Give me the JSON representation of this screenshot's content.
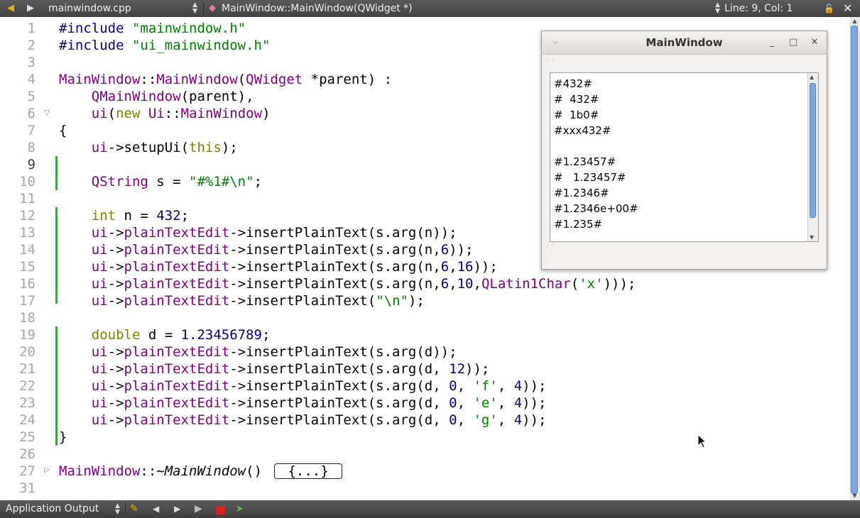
{
  "toolbar": {
    "file_name": "mainwindow.cpp",
    "symbol": "MainWindow::MainWindow(QWidget *)",
    "position": "Line: 9, Col: 1"
  },
  "editor": {
    "line_numbers": [
      "1",
      "2",
      "3",
      "4",
      "5",
      "6",
      "7",
      "8",
      "9",
      "10",
      "11",
      "12",
      "13",
      "14",
      "15",
      "16",
      "17",
      "18",
      "19",
      "20",
      "21",
      "22",
      "23",
      "24",
      "25",
      "26",
      "27",
      "31"
    ],
    "current_line": "9"
  },
  "code": {
    "l1a": "#include ",
    "l1b": "\"mainwindow.h\"",
    "l2a": "#include ",
    "l2b": "\"ui_mainwindow.h\"",
    "l4a": "MainWindow",
    "l4b": "::",
    "l4c": "MainWindow",
    "l4d": "(",
    "l4e": "QWidget",
    "l4f": " *parent) :",
    "l5a": "    ",
    "l5b": "QMainWindow",
    "l5c": "(parent),",
    "l6a": "    ",
    "l6b": "ui",
    "l6c": "(",
    "l6d": "new",
    "l6e": " ",
    "l6f": "Ui",
    "l6g": "::",
    "l6h": "MainWindow",
    "l6i": ")",
    "l7": "{",
    "l8a": "    ",
    "l8b": "ui",
    "l8c": "->setupUi(",
    "l8d": "this",
    "l8e": ");",
    "l10a": "    ",
    "l10b": "QString",
    "l10c": " s = ",
    "l10d": "\"#%1#\\n\"",
    "l10e": ";",
    "l12a": "    ",
    "l12b": "int",
    "l12c": " n = ",
    "l12d": "432",
    "l12e": ";",
    "l13": "s.arg(n));",
    "l14a": "s.arg(n,",
    "l14b": "6",
    "l14c": "));",
    "l15a": "s.arg(n,",
    "l15b": "6",
    "l15c": ",",
    "l15d": "16",
    "l15e": "));",
    "l16a": "s.arg(n,",
    "l16b": "6",
    "l16c": ",",
    "l16d": "10",
    "l16e": ",",
    "l16f": "QLatin1Char",
    "l16g": "(",
    "l16h": "'x'",
    "l16i": ")));",
    "l17a": "(",
    "l17b": "\"\\n\"",
    "l17c": ");",
    "l19a": "    ",
    "l19b": "double",
    "l19c": " d = ",
    "l19d": "1.23456789",
    "l19e": ";",
    "l20": "s.arg(d));",
    "l21a": "s.arg(d, ",
    "l21b": "12",
    "l21c": "));",
    "l22a": "s.arg(d, ",
    "l22b": "0",
    "l22c": ", ",
    "l22d": "'f'",
    "l22e": ", ",
    "l22f": "4",
    "l22g": "));",
    "l23a": "s.arg(d, ",
    "l23b": "0",
    "l23c": ", ",
    "l23d": "'e'",
    "l23e": ", ",
    "l23f": "4",
    "l23g": "));",
    "l24a": "s.arg(d, ",
    "l24b": "0",
    "l24c": ", ",
    "l24d": "'g'",
    "l24e": ", ",
    "l24f": "4",
    "l24g": "));",
    "l25": "}",
    "l27a": "MainWindow",
    "l27b": "::",
    "l27c": "~MainWindow",
    "l27d": "() ",
    "l27e": "{...}",
    "ui": "ui",
    "arrow": "->",
    "edit": "plainTextEdit",
    "insert": "->insertPlainText(",
    "insert_bare": "->insertPlainText"
  },
  "app_window": {
    "title": "MainWindow",
    "output_lines": [
      "#432#",
      "#  432#",
      "#  1b0#",
      "#xxx432#",
      "",
      "#1.23457#",
      "#   1.23457#",
      "#1.2346#",
      "#1.2346e+00#",
      "#1.235#"
    ]
  },
  "bottom": {
    "pane_label": "Application Output"
  }
}
